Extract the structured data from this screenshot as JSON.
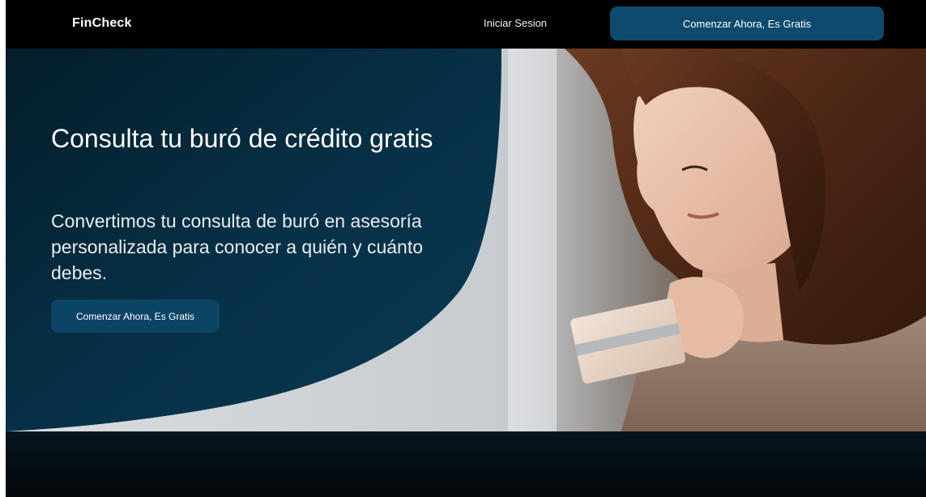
{
  "nav": {
    "brand": "FinCheck",
    "login_label": "Iniciar Sesion",
    "cta_label": "Comenzar Ahora, Es Gratis"
  },
  "hero": {
    "title": "Consulta tu buró de crédito gratis",
    "subtitle": "Convertimos tu consulta de buró en asesoría personalizada para conocer a quién y cuánto debes.",
    "cta_label": "Comenzar Ahora, Es Gratis",
    "image_icon": "woman-holding-credit-card-photo"
  },
  "colors": {
    "nav_bg": "#000000",
    "accent": "#0e4a6e",
    "hero_panel": "#052a3d",
    "footer_band": "#04121a"
  }
}
